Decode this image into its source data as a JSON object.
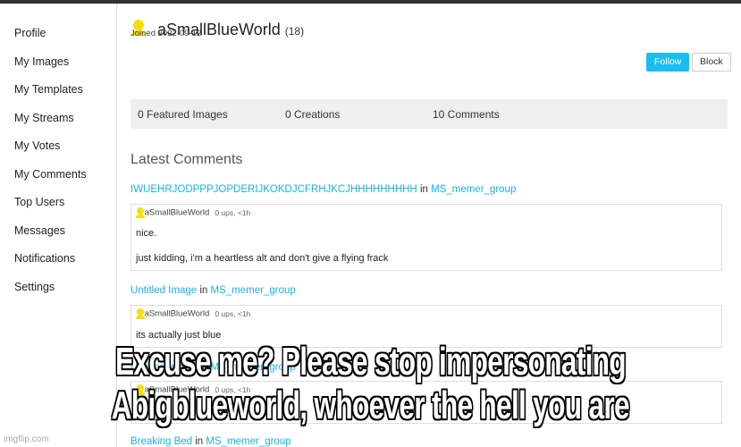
{
  "sidebar": {
    "items": [
      "Profile",
      "My Images",
      "My Templates",
      "My Streams",
      "My Votes",
      "My Comments",
      "Top Users",
      "Messages",
      "Notifications",
      "Settings"
    ]
  },
  "profile": {
    "username": "aSmallBlueWorld",
    "score": "(18)",
    "joined": "Joined 2022-09-12",
    "follow_label": "Follow",
    "block_label": "Block"
  },
  "stats": {
    "featured": "0 Featured Images",
    "creations": "0 Creations",
    "comments": "10 Comments"
  },
  "section_title": "Latest Comments",
  "comments": [
    {
      "image": "IWUEHRJODPPPJOPDERIJKOKDJCFRHJKCJHHHHHHHHH",
      "in": "in",
      "group": "MS_memer_group",
      "author": "aSmallBlueWorld",
      "meta": "0 ups, <1h",
      "lines": [
        "nice.",
        "just kidding, i'm a heartless alt and don't give a flying frack"
      ]
    },
    {
      "image": "Untitled Image",
      "in": "in",
      "group": "MS_memer_group",
      "author": "aSmallBlueWorld",
      "meta": "0 ups, <1h",
      "lines": [
        "its actually just blue"
      ]
    },
    {
      "image": "Untitled Image",
      "in": "in",
      "group": "MS_memer_group",
      "author": "aSmallBlueWorld",
      "meta": "0 ups, <1h",
      "lines": [
        ""
      ]
    },
    {
      "image": "Breaking Bed",
      "in": "in",
      "group": "MS_memer_group"
    }
  ],
  "caption": {
    "line1": "Excuse me? Please stop impersonating",
    "line2": "Abigblueworld, whoever the hell you are"
  },
  "watermark": "imgflip.com",
  "colors": {
    "accent": "#1bbcf0",
    "avatar": "#f5e100"
  }
}
